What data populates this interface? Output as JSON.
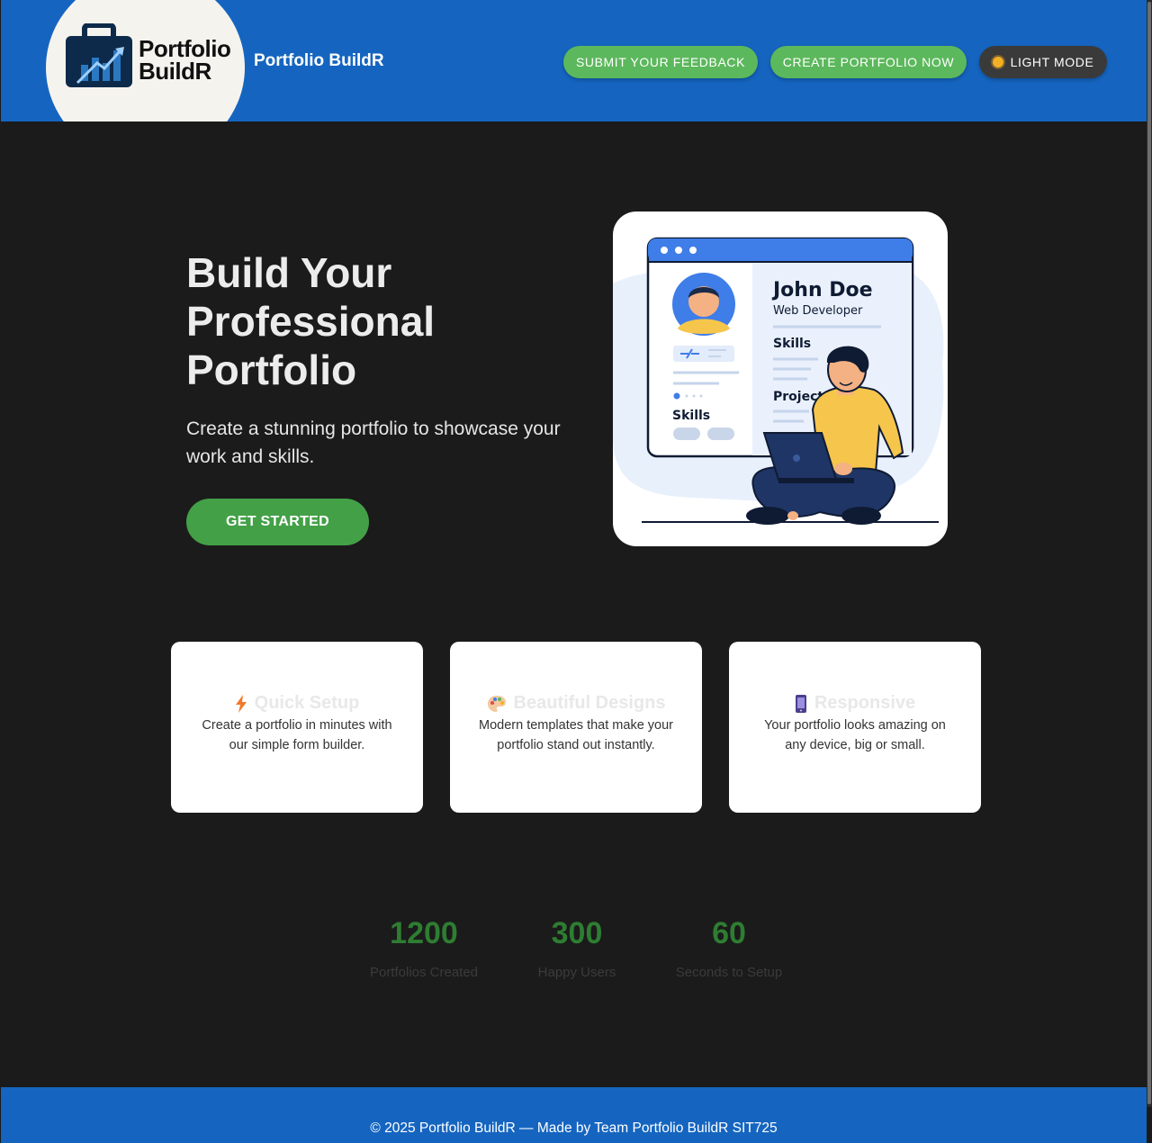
{
  "header": {
    "logo_line1": "Portfolio",
    "logo_line2": "BuildR",
    "brand": "Portfolio BuildR",
    "feedback_label": "SUBMIT YOUR FEEDBACK",
    "create_label": "CREATE PORTFOLIO NOW",
    "theme_label": "LIGHT MODE"
  },
  "hero": {
    "title": "Build Your Professional Portfolio",
    "subtitle": "Create a stunning portfolio to showcase your work and skills.",
    "cta_label": "GET STARTED",
    "illustration": {
      "name": "John Doe",
      "role": "Web Developer",
      "skills_label": "Skills",
      "projects_label": "Projects",
      "left_skills_label": "Skills"
    }
  },
  "features": [
    {
      "icon": "lightning-icon",
      "title": "Quick Setup",
      "desc": "Create a portfolio in minutes with our simple form builder."
    },
    {
      "icon": "palette-icon",
      "title": "Beautiful Designs",
      "desc": "Modern templates that make your portfolio stand out instantly."
    },
    {
      "icon": "phone-icon",
      "title": "Responsive",
      "desc": "Your portfolio looks amazing on any device, big or small."
    }
  ],
  "stats": [
    {
      "value": "1200",
      "label": "Portfolios Created"
    },
    {
      "value": "300",
      "label": "Happy Users"
    },
    {
      "value": "60",
      "label": "Seconds to Setup"
    }
  ],
  "footer": {
    "text": "© 2025 Portfolio BuildR — Made by Team Portfolio BuildR SIT725"
  },
  "colors": {
    "header_bg": "#1565c0",
    "page_bg": "#1b1b1b",
    "accent_green": "#5cb85c",
    "cta_green": "#43a047",
    "stat_green": "#2e7d32"
  }
}
